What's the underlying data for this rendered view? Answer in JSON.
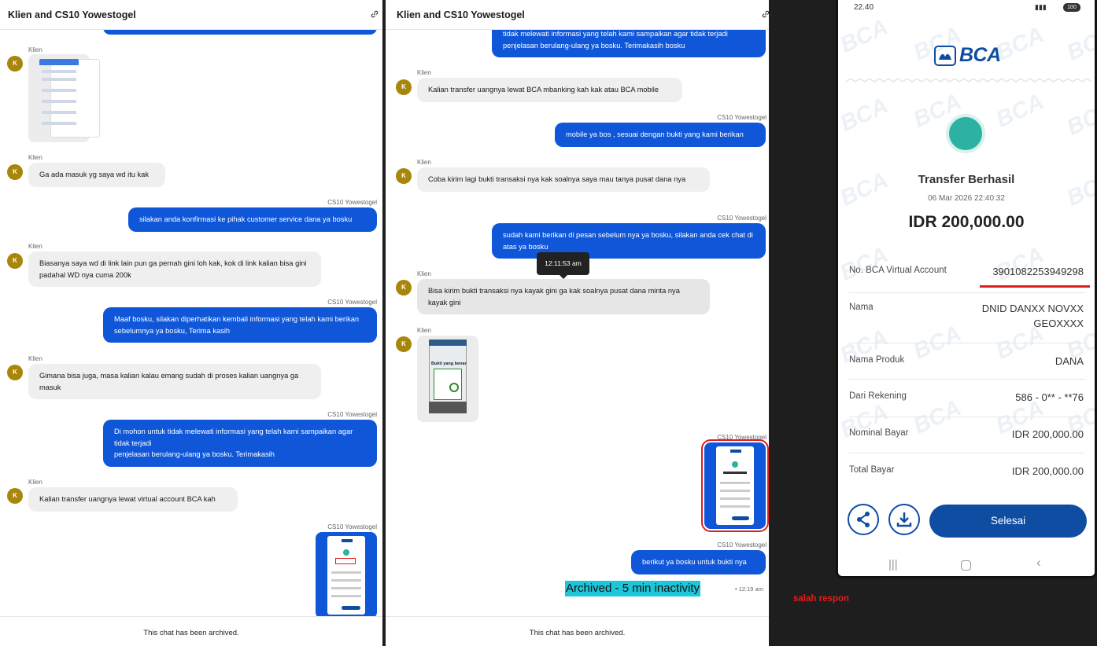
{
  "left_panel": {
    "title": "Klien and CS10 Yowestogel",
    "footer": "This chat has been archived.",
    "avatar_initial": "K",
    "messages": [
      {
        "sender": "Klien"
      },
      {
        "sender": "Klien",
        "text": "Ga ada masuk yg saya wd itu kak"
      },
      {
        "sender": "CS10 Yowestogel",
        "text": "silakan anda konfirmasi ke pihak customer service dana ya bosku"
      },
      {
        "sender": "Klien",
        "text": "Biasanya saya wd di link lain pun ga pernah gini loh kak, kok di link kalian bisa gini padahal WD nya cuma 200k"
      },
      {
        "sender": "CS10 Yowestogel",
        "text": "Maaf bosku, silakan diperhatikan kembali informasi yang telah kami berikan sebelumnya ya bosku, Terima kasih"
      },
      {
        "sender": "Klien",
        "text": "Gimana bisa juga, masa kalian kalau emang sudah di proses kalian uangnya ga masuk"
      },
      {
        "sender": "CS10 Yowestogel",
        "text": "Di mohon untuk tidak melewati informasi yang telah kami sampaikan agar tidak terjadi\npenjelasan berulang-ulang ya bosku. Terimakasih"
      },
      {
        "sender": "Klien",
        "text": "Kalian transfer uangnya lewat virtual account BCA kah"
      },
      {
        "sender": "CS10 Yowestogel"
      }
    ]
  },
  "right_panel": {
    "title": "Klien and CS10 Yowestogel",
    "footer": "This chat has been archived.",
    "avatar_initial": "K",
    "messages": [
      {
        "text": "tidak melewati informasi yang telah kami sampaikan agar tidak terjadi penjelasan berulang-ulang ya bosku. Terimakasih bosku"
      },
      {
        "sender": "Klien",
        "text": "Kalian transfer uangnya lewat BCA mbanking kah kak atau BCA mobile"
      },
      {
        "sender": "CS10 Yowestogel",
        "text": "mobile ya bos , sesuai dengan bukti yang kami berikan"
      },
      {
        "sender": "Klien",
        "text": "Coba kirim lagi bukti transaksi nya kak soalnya saya mau tanya pusat dana nya"
      },
      {
        "sender": "CS10 Yowestogel",
        "text": "sudah kami berikan di pesan sebelum nya ya bosku, silakan anda cek chat di atas ya bosku"
      },
      {
        "sender": "Klien",
        "text": "Bisa kirim bukti transaksi nya kayak gini ga kak soalnya pusat dana minta nya kayak gini"
      },
      {
        "sender": "Klien",
        "thumb_text": "Bukti yang benar"
      },
      {
        "sender": "CS10 Yowestogel"
      },
      {
        "sender": "CS10 Yowestogel",
        "text": "berikut ya bosku untuk bukti nya"
      }
    ],
    "tooltip": "12:11:53 am",
    "archived_notice": "Archived - 5 min inactivity",
    "archived_time": "• 12:19 am"
  },
  "annotation": "salah respon",
  "receipt": {
    "status_time": "22.40",
    "battery": "100",
    "bank": "BCA",
    "watermark": "BCA",
    "title": "Transfer Berhasil",
    "datetime": "06 Mar 2026 22:40:32",
    "amount": "IDR 200,000.00",
    "rows": [
      {
        "label": "No. BCA Virtual Account",
        "value": "3901082253949298"
      },
      {
        "label": "Nama",
        "value": "DNID DANXX NOVXX GEOXXXX"
      },
      {
        "label": "Nama Produk",
        "value": "DANA"
      },
      {
        "label": "Dari Rekening",
        "value": "586 - 0** - **76"
      },
      {
        "label": "Nominal Bayar",
        "value": "IDR 200,000.00"
      },
      {
        "label": "Total Bayar",
        "value": "IDR 200,000.00"
      }
    ],
    "done_button": "Selesai",
    "colors": {
      "brand": "#0f4da2",
      "success": "#2db1a3",
      "highlight": "#e01e1e"
    }
  }
}
